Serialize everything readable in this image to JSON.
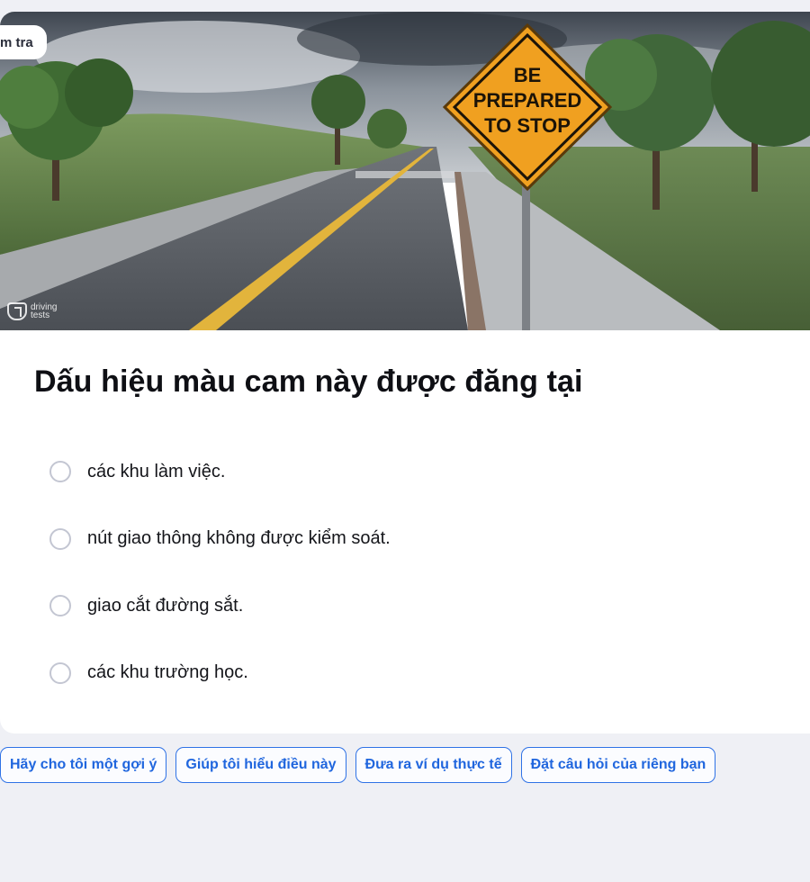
{
  "header": {
    "tag_label": "m tra"
  },
  "scene": {
    "sign_lines": [
      "BE",
      "PREPARED",
      "TO STOP"
    ],
    "watermark_lines": [
      "driving",
      "tests"
    ],
    "sign_color": "#f0a020"
  },
  "question": {
    "text": "Dấu hiệu màu cam này được đăng tại"
  },
  "options": [
    {
      "label": "các khu làm việc."
    },
    {
      "label": "nút giao thông không được kiểm soát."
    },
    {
      "label": "giao cắt đường sắt."
    },
    {
      "label": "các khu trường học."
    }
  ],
  "help_chips": [
    {
      "label": "Hãy cho tôi một gợi ý"
    },
    {
      "label": "Giúp tôi hiểu điều này"
    },
    {
      "label": "Đưa ra ví dụ thực tế"
    },
    {
      "label": "Đặt câu hỏi của riêng bạn"
    }
  ],
  "colors": {
    "accent": "#2f72e6",
    "background": "#eff0f5"
  }
}
